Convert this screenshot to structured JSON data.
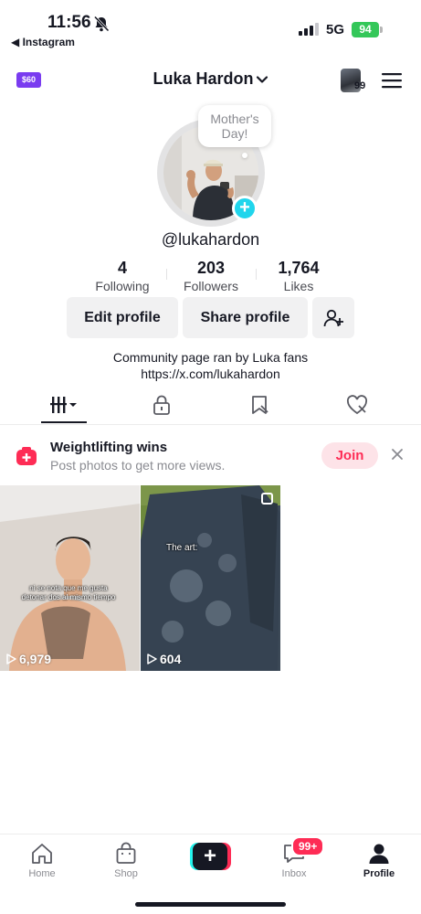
{
  "status_bar": {
    "time": "11:56",
    "back_app": "◀ Instagram",
    "network": "5G",
    "battery_level": "94"
  },
  "header": {
    "coin_label": "$60",
    "username": "Luka Hardon",
    "mini_avatar_count": "99"
  },
  "profile": {
    "note": "Mother's Day!",
    "handle": "@lukahardon",
    "stats": [
      {
        "value": "4",
        "label": "Following"
      },
      {
        "value": "203",
        "label": "Followers"
      },
      {
        "value": "1,764",
        "label": "Likes"
      }
    ],
    "edit_label": "Edit profile",
    "share_label": "Share profile",
    "bio_line1": "Community page ran by Luka fans",
    "bio_line2": "https://x.com/lukahardon"
  },
  "tabs": [
    "videos-grid-icon",
    "lock-icon",
    "repost-icon",
    "liked-heart-icon"
  ],
  "promo": {
    "title": "Weightlifting wins",
    "subtitle": "Post photos to get more views.",
    "join_label": "Join"
  },
  "videos": [
    {
      "views": "6,979",
      "caption": "ni se nota que me gusta detonar dos al mismo tiempo"
    },
    {
      "views": "604",
      "caption": "The art:"
    }
  ],
  "bottom_nav": {
    "home": "Home",
    "shop": "Shop",
    "inbox": "Inbox",
    "inbox_badge": "99+",
    "profile": "Profile"
  },
  "colors": {
    "accent": "#fe2c55",
    "cyan": "#25f4ee",
    "battery": "#34c759",
    "coin": "#7a3cf0"
  }
}
